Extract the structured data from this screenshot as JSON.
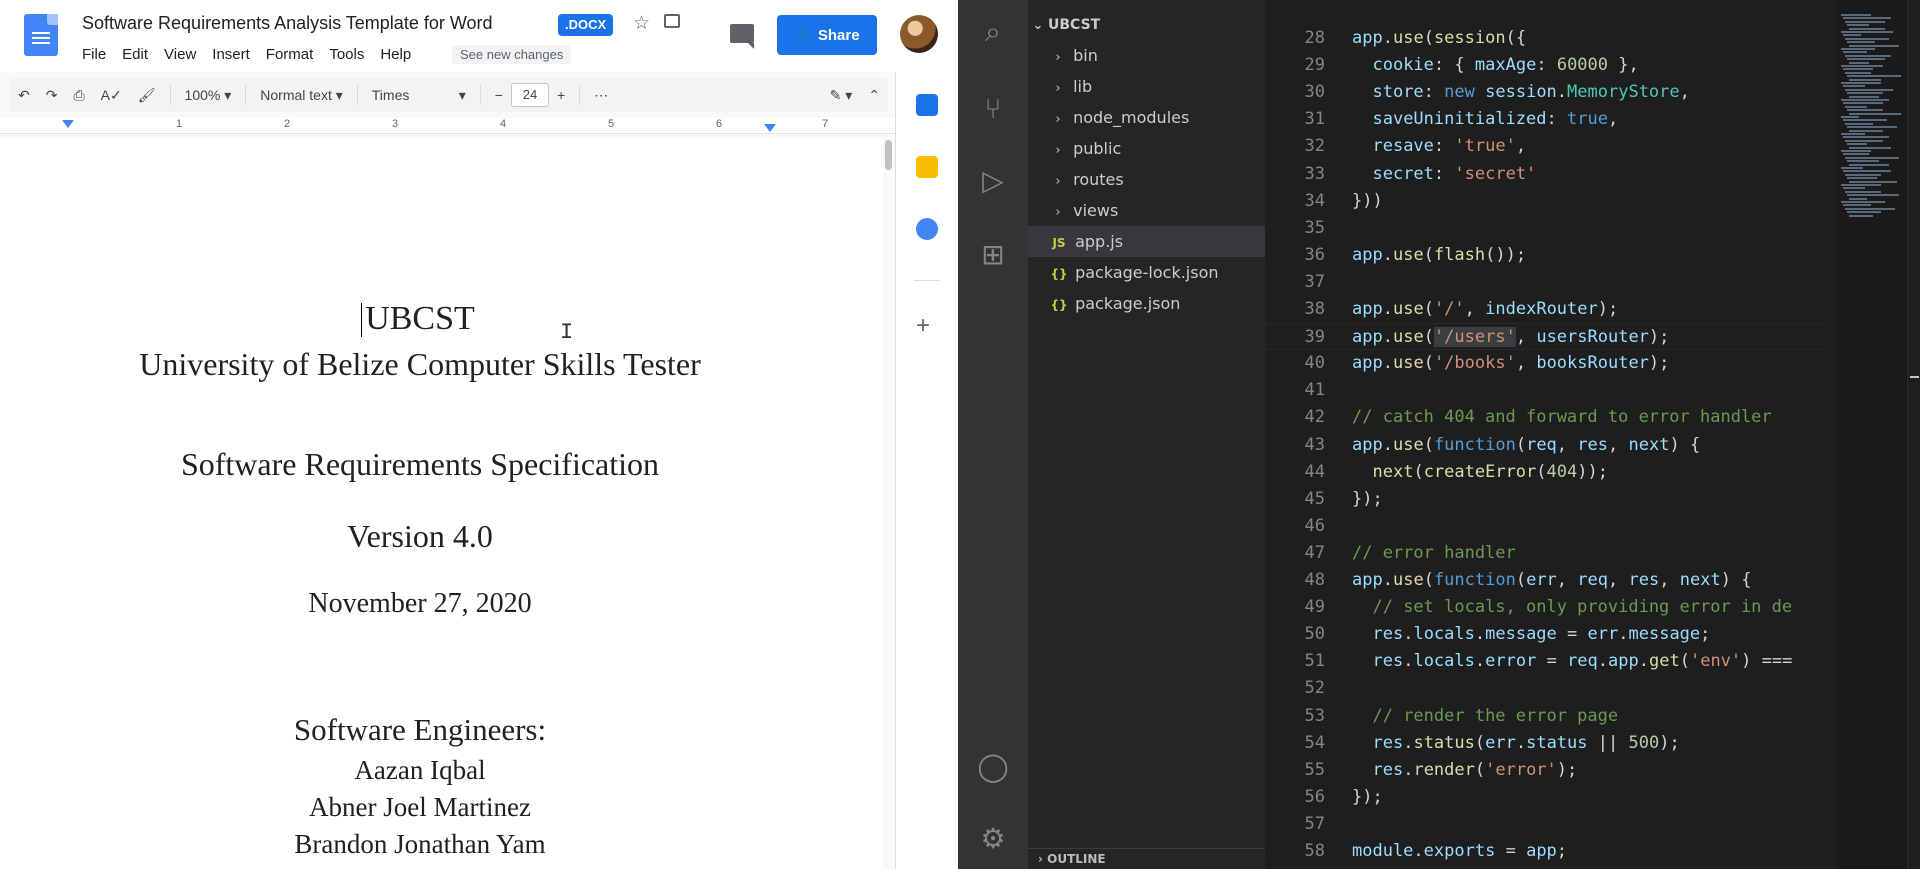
{
  "docs": {
    "title": "Software Requirements Analysis Template for Word",
    "badge": ".DOCX",
    "menu": [
      "File",
      "Edit",
      "View",
      "Insert",
      "Format",
      "Tools",
      "Help"
    ],
    "see_changes": "See new changes",
    "share_label": "Share",
    "toolbar": {
      "zoom": "100%",
      "style": "Normal text",
      "font": "Times",
      "font_size": "24",
      "minus": "−",
      "plus": "+",
      "more": "⋯"
    },
    "ruler_numbers": [
      "1",
      "2",
      "3",
      "4",
      "5",
      "6",
      "7"
    ],
    "content": {
      "line1": "UBCST",
      "line2": "University of Belize Computer Skills Tester",
      "line3": "Software Requirements Specification",
      "line4": "Version 4.0",
      "line5": "November 27, 2020",
      "line6": "Software Engineers:",
      "line7": "Aazan Iqbal",
      "line8": "Abner Joel Martinez",
      "line9": "Brandon Jonathan Yam"
    }
  },
  "vscode": {
    "explorer": {
      "root": "UBCST",
      "folders": [
        "bin",
        "lib",
        "node_modules",
        "public",
        "routes",
        "views"
      ],
      "files": [
        {
          "icon": "JS",
          "name": "app.js",
          "selected": true
        },
        {
          "icon": "{}",
          "name": "package-lock.json",
          "selected": false
        },
        {
          "icon": "{}",
          "name": "package.json",
          "selected": false
        }
      ],
      "outline": "OUTLINE"
    },
    "code": [
      {
        "n": "28",
        "text": "app.use(session({"
      },
      {
        "n": "29",
        "text": "  cookie: { maxAge: 60000 },"
      },
      {
        "n": "30",
        "text": "  store: new session.MemoryStore,"
      },
      {
        "n": "31",
        "text": "  saveUninitialized: true,"
      },
      {
        "n": "32",
        "text": "  resave: 'true',"
      },
      {
        "n": "33",
        "text": "  secret: 'secret'"
      },
      {
        "n": "34",
        "text": "}))"
      },
      {
        "n": "35",
        "text": ""
      },
      {
        "n": "36",
        "text": "app.use(flash());"
      },
      {
        "n": "37",
        "text": ""
      },
      {
        "n": "38",
        "text": "app.use('/', indexRouter);"
      },
      {
        "n": "39",
        "text": "app.use('/users', usersRouter);"
      },
      {
        "n": "40",
        "text": "app.use('/books', booksRouter);"
      },
      {
        "n": "41",
        "text": ""
      },
      {
        "n": "42",
        "text": "// catch 404 and forward to error handler"
      },
      {
        "n": "43",
        "text": "app.use(function(req, res, next) {"
      },
      {
        "n": "44",
        "text": "  next(createError(404));"
      },
      {
        "n": "45",
        "text": "});"
      },
      {
        "n": "46",
        "text": ""
      },
      {
        "n": "47",
        "text": "// error handler"
      },
      {
        "n": "48",
        "text": "app.use(function(err, req, res, next) {"
      },
      {
        "n": "49",
        "text": "  // set locals, only providing error in de"
      },
      {
        "n": "50",
        "text": "  res.locals.message = err.message;"
      },
      {
        "n": "51",
        "text": "  res.locals.error = req.app.get('env') ==="
      },
      {
        "n": "52",
        "text": ""
      },
      {
        "n": "53",
        "text": "  // render the error page"
      },
      {
        "n": "54",
        "text": "  res.status(err.status || 500);"
      },
      {
        "n": "55",
        "text": "  res.render('error');"
      },
      {
        "n": "56",
        "text": "});"
      },
      {
        "n": "57",
        "text": ""
      },
      {
        "n": "58",
        "text": "module.exports = app;"
      }
    ]
  },
  "colors": {
    "docs_accent": "#1a73e8",
    "vscode_bg": "#1e1e1e",
    "vscode_sidebar": "#252526",
    "vscode_activity": "#333333"
  }
}
